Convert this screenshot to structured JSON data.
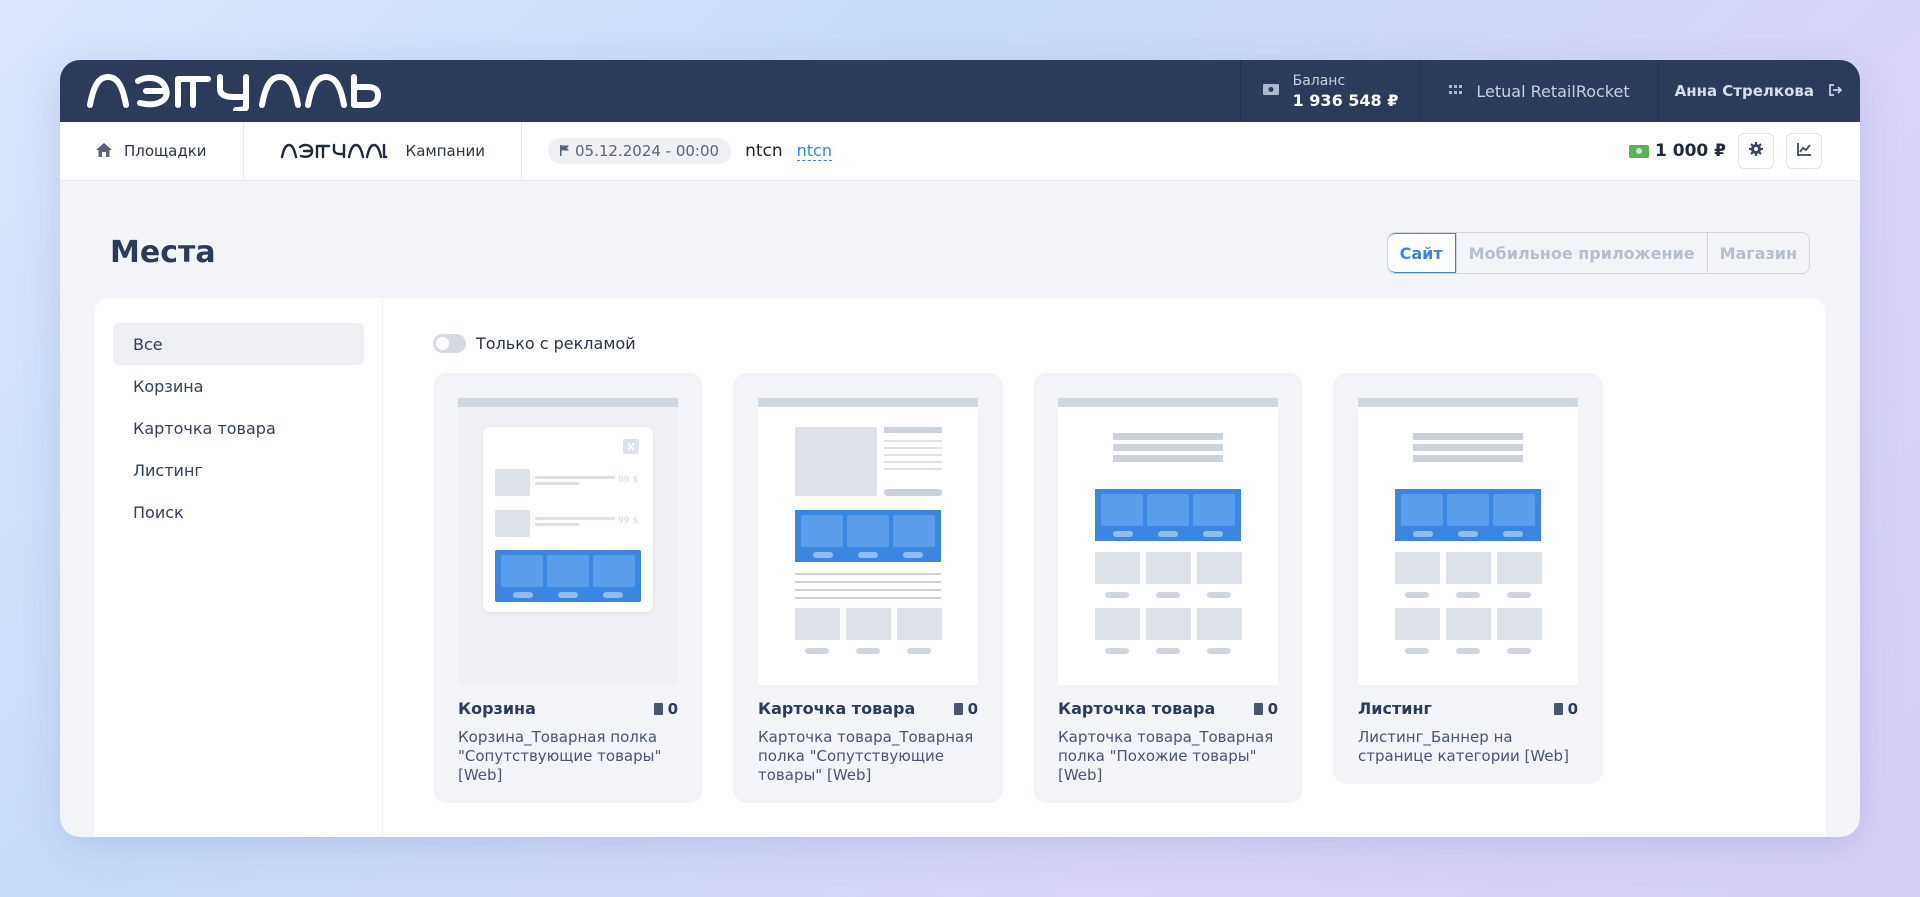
{
  "header": {
    "brand": "ЛЭТУАЛЬ",
    "balance_label": "Баланс",
    "balance_value": "1 936 548 ₽",
    "project": "Letual RetailRocket",
    "user": "Анна Стрелкова"
  },
  "subbar": {
    "home_label": "Площадки",
    "brand_small": "ЛЭТУАЛЬ",
    "campaigns_label": "Кампании",
    "date": "05.12.2024 - 00:00",
    "campaign_name": "ntcn",
    "campaign_link": "ntcn",
    "budget": "1 000 ₽"
  },
  "page": {
    "title": "Места",
    "segments": [
      "Сайт",
      "Мобильное приложение",
      "Магазин"
    ],
    "toggle_label": "Только с рекламой"
  },
  "sidebar": {
    "items": [
      {
        "label": "Все"
      },
      {
        "label": "Корзина"
      },
      {
        "label": "Карточка товара"
      },
      {
        "label": "Листинг"
      },
      {
        "label": "Поиск"
      }
    ]
  },
  "cards": [
    {
      "title": "Корзина",
      "count": "0",
      "desc": "Корзина_Товарная полка \"Сопутствующие товары\" [Web]",
      "price": "99 $"
    },
    {
      "title": "Карточка товара",
      "count": "0",
      "desc": "Карточка товара_Товарная полка \"Сопутствующие товары\" [Web]"
    },
    {
      "title": "Карточка товара",
      "count": "0",
      "desc": "Карточка товара_Товарная полка \"Похожие товары\" [Web]"
    },
    {
      "title": "Листинг",
      "count": "0",
      "desc": "Листинг_Баннер на странице категории [Web]"
    }
  ],
  "colors": {
    "topbar": "#2c3b59",
    "accent": "#3a86e0",
    "money": "#5bb25a"
  },
  "icons": [
    "cash-icon",
    "grid-icon",
    "logout-icon",
    "home-icon",
    "flag-icon",
    "gear-icon",
    "chart-icon",
    "document-icon",
    "close-icon"
  ]
}
